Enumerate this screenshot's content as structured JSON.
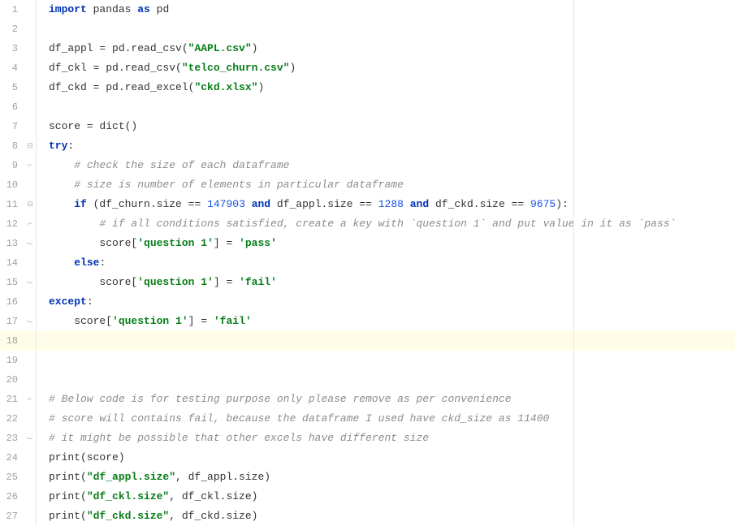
{
  "lines": [
    {
      "num": "1",
      "fold": "",
      "tokens": [
        {
          "t": "kw",
          "s": "import"
        },
        {
          "t": "id",
          "s": " pandas "
        },
        {
          "t": "kw",
          "s": "as"
        },
        {
          "t": "id",
          "s": " pd"
        }
      ],
      "current": false
    },
    {
      "num": "2",
      "fold": "",
      "tokens": [],
      "current": false
    },
    {
      "num": "3",
      "fold": "",
      "tokens": [
        {
          "t": "id",
          "s": "df_appl = pd.read_csv("
        },
        {
          "t": "str",
          "s": "\"AAPL.csv\""
        },
        {
          "t": "id",
          "s": ")"
        }
      ],
      "current": false
    },
    {
      "num": "4",
      "fold": "",
      "tokens": [
        {
          "t": "id",
          "s": "df_ckl = pd.read_csv("
        },
        {
          "t": "str",
          "s": "\"telco_churn.csv\""
        },
        {
          "t": "id",
          "s": ")"
        }
      ],
      "current": false
    },
    {
      "num": "5",
      "fold": "",
      "tokens": [
        {
          "t": "id",
          "s": "df_ckd = pd.read_excel("
        },
        {
          "t": "str",
          "s": "\"ckd.xlsx\""
        },
        {
          "t": "id",
          "s": ")"
        }
      ],
      "current": false
    },
    {
      "num": "6",
      "fold": "",
      "tokens": [],
      "current": false
    },
    {
      "num": "7",
      "fold": "",
      "tokens": [
        {
          "t": "id",
          "s": "score = dict()"
        }
      ],
      "current": false
    },
    {
      "num": "8",
      "fold": "⊟",
      "tokens": [
        {
          "t": "kw",
          "s": "try"
        },
        {
          "t": "id",
          "s": ":"
        }
      ],
      "current": false
    },
    {
      "num": "9",
      "fold": "⌐",
      "tokens": [
        {
          "t": "id",
          "s": "    "
        },
        {
          "t": "com",
          "s": "# check the size of each dataframe"
        }
      ],
      "current": false
    },
    {
      "num": "10",
      "fold": "",
      "tokens": [
        {
          "t": "id",
          "s": "    "
        },
        {
          "t": "com",
          "s": "# size is number of elements in particular dataframe"
        }
      ],
      "current": false
    },
    {
      "num": "11",
      "fold": "⊟",
      "tokens": [
        {
          "t": "id",
          "s": "    "
        },
        {
          "t": "kw",
          "s": "if"
        },
        {
          "t": "id",
          "s": " (df_churn.size == "
        },
        {
          "t": "num",
          "s": "147903"
        },
        {
          "t": "id",
          "s": " "
        },
        {
          "t": "kw",
          "s": "and"
        },
        {
          "t": "id",
          "s": " df_appl.size == "
        },
        {
          "t": "num",
          "s": "1288"
        },
        {
          "t": "id",
          "s": " "
        },
        {
          "t": "kw",
          "s": "and"
        },
        {
          "t": "id",
          "s": " df_ckd.size == "
        },
        {
          "t": "num",
          "s": "9675"
        },
        {
          "t": "id",
          "s": "):"
        }
      ],
      "current": false
    },
    {
      "num": "12",
      "fold": "⌐",
      "tokens": [
        {
          "t": "id",
          "s": "        "
        },
        {
          "t": "com",
          "s": "# if all conditions satisfied, create a key with `question 1` and put value in it as `pass`"
        }
      ],
      "current": false
    },
    {
      "num": "13",
      "fold": "⌙",
      "tokens": [
        {
          "t": "id",
          "s": "        score["
        },
        {
          "t": "str",
          "s": "'question 1'"
        },
        {
          "t": "id",
          "s": "] = "
        },
        {
          "t": "str",
          "s": "'pass'"
        }
      ],
      "current": false
    },
    {
      "num": "14",
      "fold": "",
      "tokens": [
        {
          "t": "id",
          "s": "    "
        },
        {
          "t": "kw",
          "s": "else"
        },
        {
          "t": "id",
          "s": ":"
        }
      ],
      "current": false
    },
    {
      "num": "15",
      "fold": "⌙",
      "tokens": [
        {
          "t": "id",
          "s": "        score["
        },
        {
          "t": "str",
          "s": "'question 1'"
        },
        {
          "t": "id",
          "s": "] = "
        },
        {
          "t": "str",
          "s": "'fail'"
        }
      ],
      "current": false
    },
    {
      "num": "16",
      "fold": "",
      "tokens": [
        {
          "t": "kw",
          "s": "except"
        },
        {
          "t": "id",
          "s": ":"
        }
      ],
      "current": false
    },
    {
      "num": "17",
      "fold": "⌙",
      "tokens": [
        {
          "t": "id",
          "s": "    score["
        },
        {
          "t": "str",
          "s": "'question 1'"
        },
        {
          "t": "id",
          "s": "] = "
        },
        {
          "t": "str",
          "s": "'fail'"
        }
      ],
      "current": false
    },
    {
      "num": "18",
      "fold": "",
      "tokens": [],
      "current": true
    },
    {
      "num": "19",
      "fold": "",
      "tokens": [],
      "current": false
    },
    {
      "num": "20",
      "fold": "",
      "tokens": [],
      "current": false
    },
    {
      "num": "21",
      "fold": "⌐",
      "tokens": [
        {
          "t": "com",
          "s": "# Below code is for testing purpose only please remove as per convenience"
        }
      ],
      "current": false
    },
    {
      "num": "22",
      "fold": "",
      "tokens": [
        {
          "t": "com",
          "s": "# score will contains fail, because the dataframe I used have ckd_size as 11400"
        }
      ],
      "current": false
    },
    {
      "num": "23",
      "fold": "⌙",
      "tokens": [
        {
          "t": "com",
          "s": "# it might be possible that other excels have different size"
        }
      ],
      "current": false
    },
    {
      "num": "24",
      "fold": "",
      "tokens": [
        {
          "t": "id",
          "s": "print(score)"
        }
      ],
      "current": false
    },
    {
      "num": "25",
      "fold": "",
      "tokens": [
        {
          "t": "id",
          "s": "print("
        },
        {
          "t": "str",
          "s": "\"df_appl.size\""
        },
        {
          "t": "id",
          "s": ", df_appl.size)"
        }
      ],
      "current": false
    },
    {
      "num": "26",
      "fold": "",
      "tokens": [
        {
          "t": "id",
          "s": "print("
        },
        {
          "t": "str",
          "s": "\"df_ckl.size\""
        },
        {
          "t": "id",
          "s": ", df_ckl.size)"
        }
      ],
      "current": false
    },
    {
      "num": "27",
      "fold": "",
      "tokens": [
        {
          "t": "id",
          "s": "print("
        },
        {
          "t": "str",
          "s": "\"df_ckd.size\""
        },
        {
          "t": "id",
          "s": ", df_ckd.size)"
        }
      ],
      "current": false
    }
  ]
}
